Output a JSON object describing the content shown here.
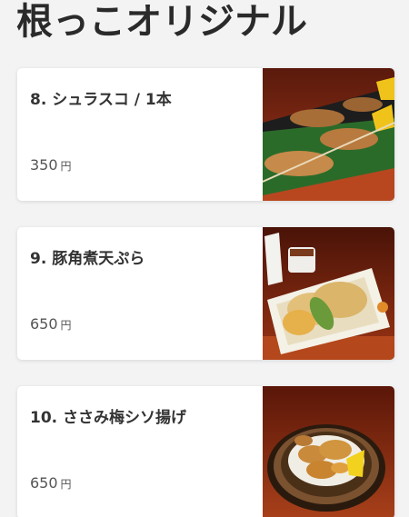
{
  "section": {
    "title": "根っこオリジナル"
  },
  "menu_items": [
    {
      "name": "8. シュラスコ / 1本",
      "price": "350",
      "currency": "円",
      "image": "skewer-photo"
    },
    {
      "name": "9. 豚角煮天ぷら",
      "price": "650",
      "currency": "円",
      "image": "tempura-photo"
    },
    {
      "name": "10. ささみ梅シソ揚げ",
      "price": "650",
      "currency": "円",
      "image": "fried-chicken-basket-photo"
    }
  ]
}
